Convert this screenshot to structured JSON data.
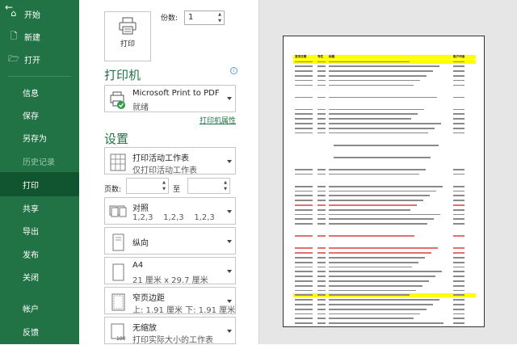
{
  "sidebar": {
    "back_icon": "back-arrow-icon",
    "items": [
      {
        "label": "开始",
        "icon": "home-icon"
      },
      {
        "label": "新建",
        "icon": "new-file-icon"
      },
      {
        "label": "打开",
        "icon": "folder-open-icon"
      },
      {
        "label": "信息"
      },
      {
        "label": "保存"
      },
      {
        "label": "另存为"
      },
      {
        "label": "历史记录"
      },
      {
        "label": "打印"
      },
      {
        "label": "共享"
      },
      {
        "label": "导出"
      },
      {
        "label": "发布"
      },
      {
        "label": "关闭"
      },
      {
        "label": "帐户"
      },
      {
        "label": "反馈"
      }
    ],
    "selected": "打印",
    "disabled": "历史记录",
    "bg_color": "#217346",
    "selected_color": "#10552f"
  },
  "print": {
    "button_label": "打印",
    "copies_label": "份数:",
    "copies_value": "1"
  },
  "printer": {
    "section_title": "打印机",
    "name": "Microsoft Print to PDF",
    "status": "就绪",
    "properties_link": "打印机属性"
  },
  "settings": {
    "section_title": "设置",
    "what": {
      "title": "打印活动工作表",
      "subtitle": "仅打印活动工作表"
    },
    "pages_label": "页数:",
    "to_label": "至",
    "collate": {
      "title": "对照",
      "subtitle": "1,2,3    1,2,3    1,2,3"
    },
    "orientation": {
      "title": "纵向"
    },
    "paper": {
      "title": "A4",
      "subtitle": "21 厘米 x 29.7 厘米"
    },
    "margins": {
      "title": "窄页边距",
      "subtitle": "上: 1.91 厘米 下: 1.91 厘米"
    },
    "scaling": {
      "title": "无缩放",
      "subtitle": "打印实际大小的工作表"
    }
  },
  "preview": {
    "header": [
      "发布日期",
      "专栏",
      "标题",
      "账户作者"
    ],
    "rows": [
      {
        "type": "hl"
      },
      {
        "type": "n"
      },
      {
        "type": "n"
      },
      {
        "type": "n"
      },
      {
        "type": "n"
      },
      {
        "type": "n"
      },
      {
        "type": "gap"
      },
      {
        "type": "n"
      },
      {
        "type": "gap"
      },
      {
        "type": "n"
      },
      {
        "type": "n"
      },
      {
        "type": "n"
      },
      {
        "type": "n"
      },
      {
        "type": "n"
      },
      {
        "type": "n"
      },
      {
        "type": "gap"
      },
      {
        "type": "center"
      },
      {
        "type": "gap"
      },
      {
        "type": "center"
      },
      {
        "type": "gap"
      },
      {
        "type": "n"
      },
      {
        "type": "n"
      },
      {
        "type": "gap"
      },
      {
        "type": "n"
      },
      {
        "type": "n"
      },
      {
        "type": "n"
      },
      {
        "type": "n"
      },
      {
        "type": "red"
      },
      {
        "type": "n"
      },
      {
        "type": "n"
      },
      {
        "type": "n"
      },
      {
        "type": "n"
      },
      {
        "type": "gap"
      },
      {
        "type": "red"
      },
      {
        "type": "gap"
      },
      {
        "type": "red"
      },
      {
        "type": "red"
      },
      {
        "type": "n"
      },
      {
        "type": "n"
      },
      {
        "type": "n"
      },
      {
        "type": "n"
      },
      {
        "type": "n"
      },
      {
        "type": "n"
      },
      {
        "type": "n"
      },
      {
        "type": "n"
      },
      {
        "type": "hl"
      },
      {
        "type": "n"
      },
      {
        "type": "n"
      },
      {
        "type": "n"
      },
      {
        "type": "n"
      },
      {
        "type": "n"
      },
      {
        "type": "n"
      }
    ]
  }
}
